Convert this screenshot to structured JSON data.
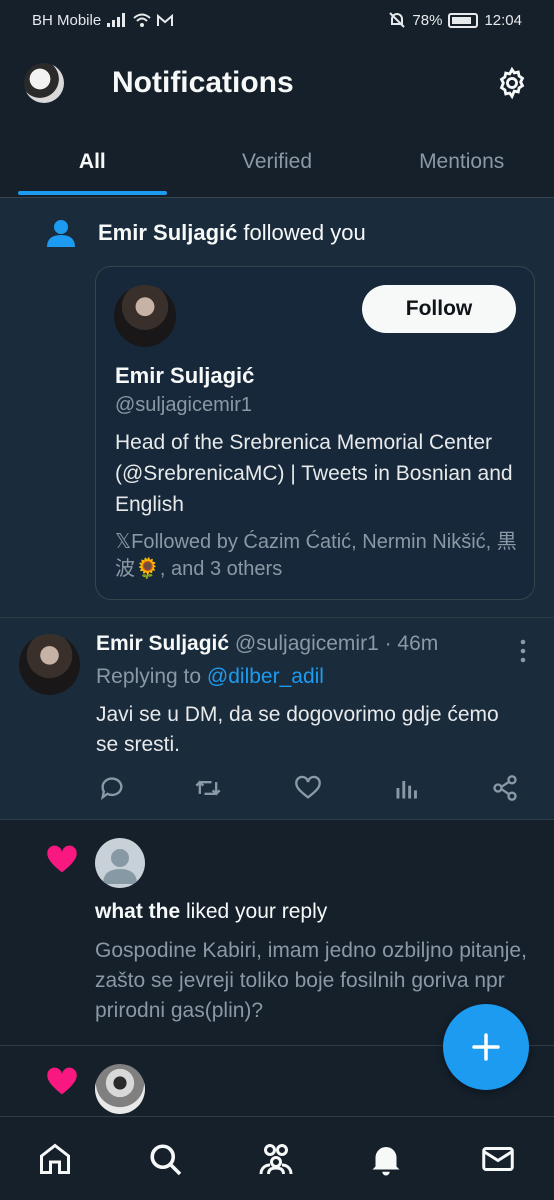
{
  "status_bar": {
    "carrier": "BH Mobile",
    "battery": "78%",
    "time": "12:04"
  },
  "header": {
    "title": "Notifications"
  },
  "tabs": [
    {
      "label": "All",
      "active": true
    },
    {
      "label": "Verified",
      "active": false
    },
    {
      "label": "Mentions",
      "active": false
    }
  ],
  "follow_notification": {
    "name": "Emir Suljagić",
    "action_text": "followed you",
    "card": {
      "follow_label": "Follow",
      "name": "Emir Suljagić",
      "handle": "@suljagicemir1",
      "bio": "Head of the Srebrenica Memorial Center (@SrebrenicaMC) | Tweets in Bosnian and English",
      "followed_by": "𝕏Followed by Ćazim Ćatić, Nermin Nikšić, 黒波🌻, and 3 others"
    }
  },
  "tweet": {
    "name": "Emir Suljagić",
    "meta": "@suljagicemir1 · 46m",
    "replying_label": "Replying to",
    "replying_to": "@dilber_adil",
    "text": "Javi se u DM, da se dogovorimo gdje ćemo se sresti."
  },
  "like_notification": {
    "name": "what the",
    "action_text": "liked your reply",
    "quote": "Gospodine Kabiri, imam jedno ozbiljno pitanje, zašto se jevreji toliko boje fosilnih goriva npr prirodni gas(plin)?"
  },
  "colors": {
    "background": "#15202b",
    "highlight_background": "#1a2b3c",
    "accent": "#1d9bf0",
    "like_pink": "#f91880"
  }
}
